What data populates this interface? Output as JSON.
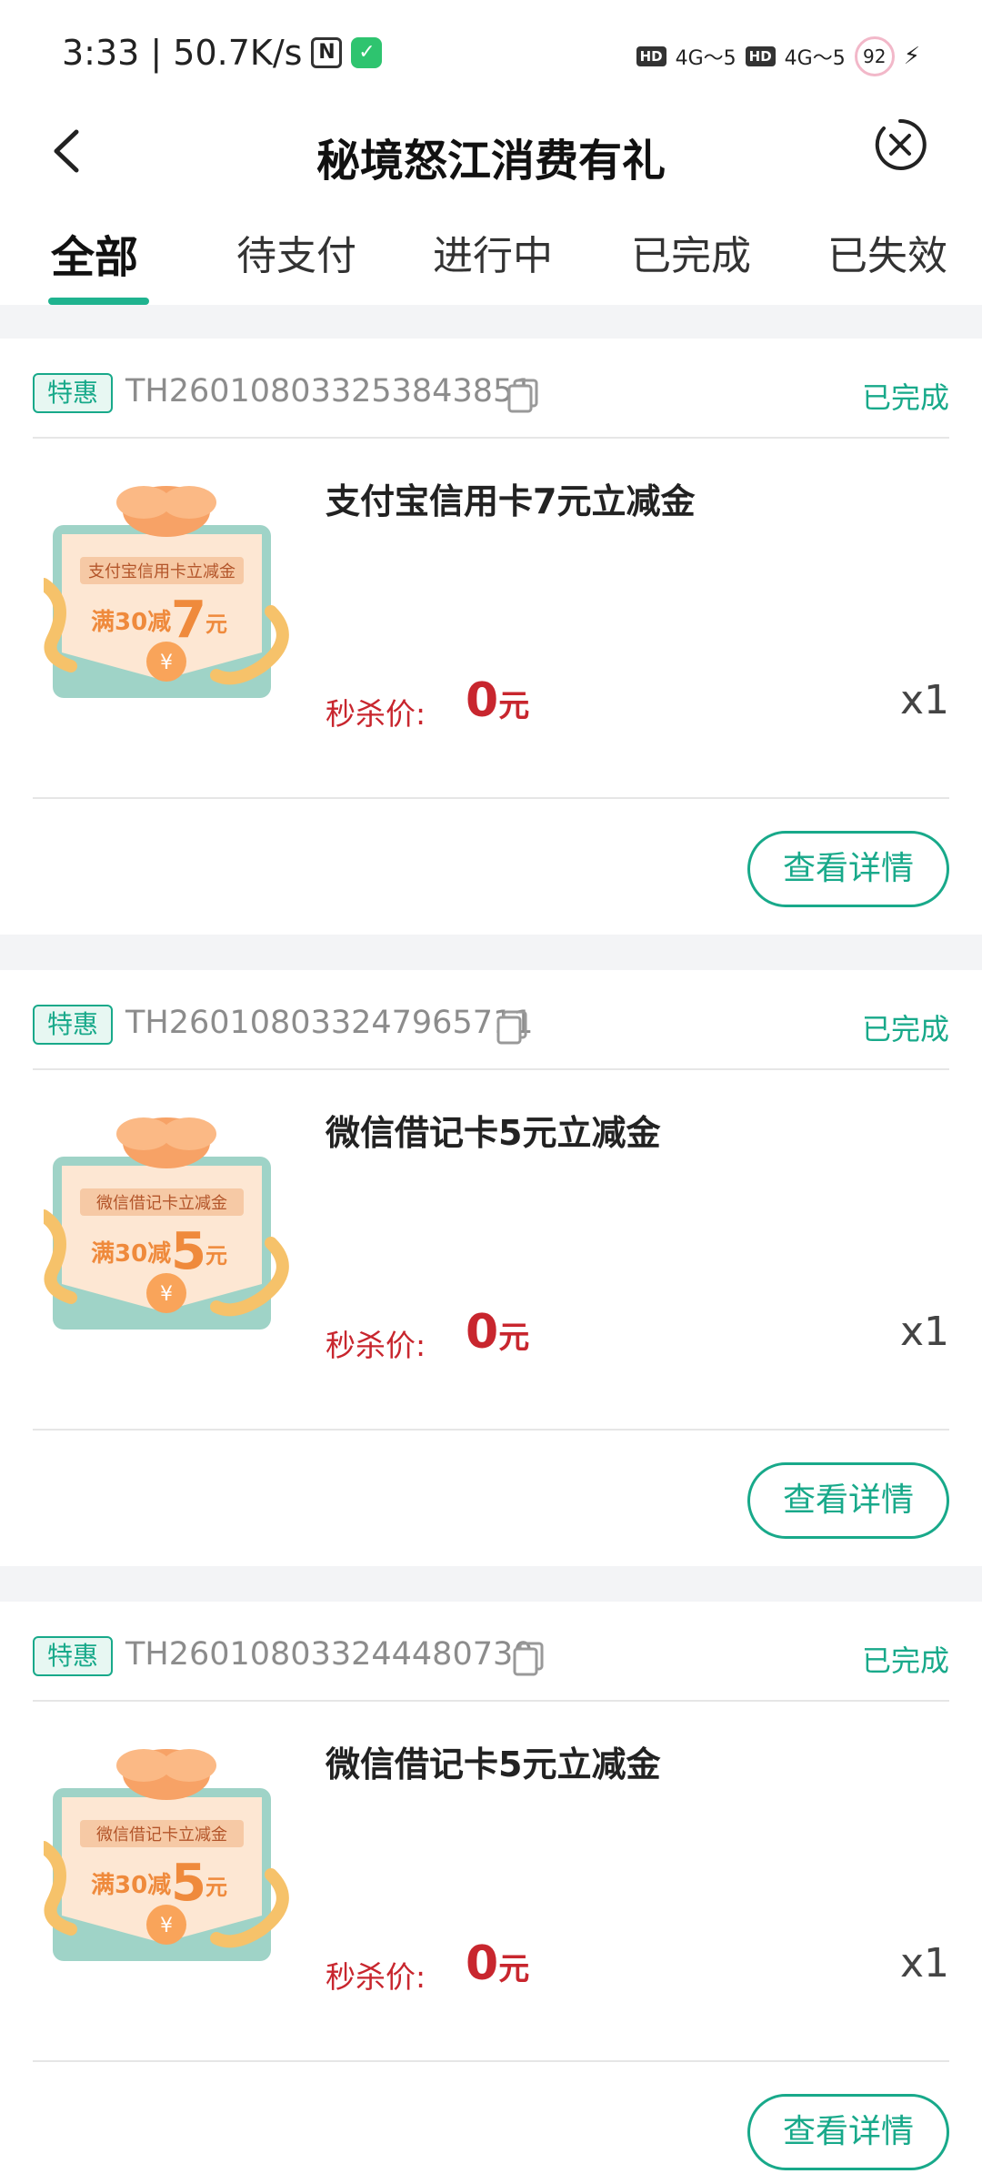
{
  "status_bar": {
    "time_speed": "3:33 | 50.7K/s",
    "hd1": "HD",
    "net1": "4G",
    "sig1": "5",
    "hd2": "HD",
    "net2": "4G",
    "sig2": "5",
    "battery": "92"
  },
  "header": {
    "title": "秘境怒江消费有礼"
  },
  "tabs": [
    {
      "label": "全部"
    },
    {
      "label": "待支付"
    },
    {
      "label": "进行中"
    },
    {
      "label": "已完成"
    },
    {
      "label": "已失效"
    }
  ],
  "orders": [
    {
      "badge": "特惠",
      "order_no": "TH260108033253843851",
      "status": "已完成",
      "thumb_title": "支付宝信用卡立减金",
      "thumb_prefix": "满30减",
      "thumb_amount": "7",
      "thumb_unit": "元",
      "product_name": "支付宝信用卡7元立减金",
      "price_label": "秒杀价:",
      "price": "0",
      "price_unit": "元",
      "qty": "x1",
      "detail_label": "查看详情"
    },
    {
      "badge": "特惠",
      "order_no": "TH260108033247965711",
      "status": "已完成",
      "thumb_title": "微信借记卡立减金",
      "thumb_prefix": "满30减",
      "thumb_amount": "5",
      "thumb_unit": "元",
      "product_name": "微信借记卡5元立减金",
      "price_label": "秒杀价:",
      "price": "0",
      "price_unit": "元",
      "qty": "x1",
      "detail_label": "查看详情"
    },
    {
      "badge": "特惠",
      "order_no": "TH260108033244480730",
      "status": "已完成",
      "thumb_title": "微信借记卡立减金",
      "thumb_prefix": "满30减",
      "thumb_amount": "5",
      "thumb_unit": "元",
      "product_name": "微信借记卡5元立减金",
      "price_label": "秒杀价:",
      "price": "0",
      "price_unit": "元",
      "qty": "x1",
      "detail_label": "查看详情"
    }
  ],
  "colors": {
    "accent": "#18a98a",
    "price": "#c8262e",
    "background": "#f3f4f6"
  }
}
